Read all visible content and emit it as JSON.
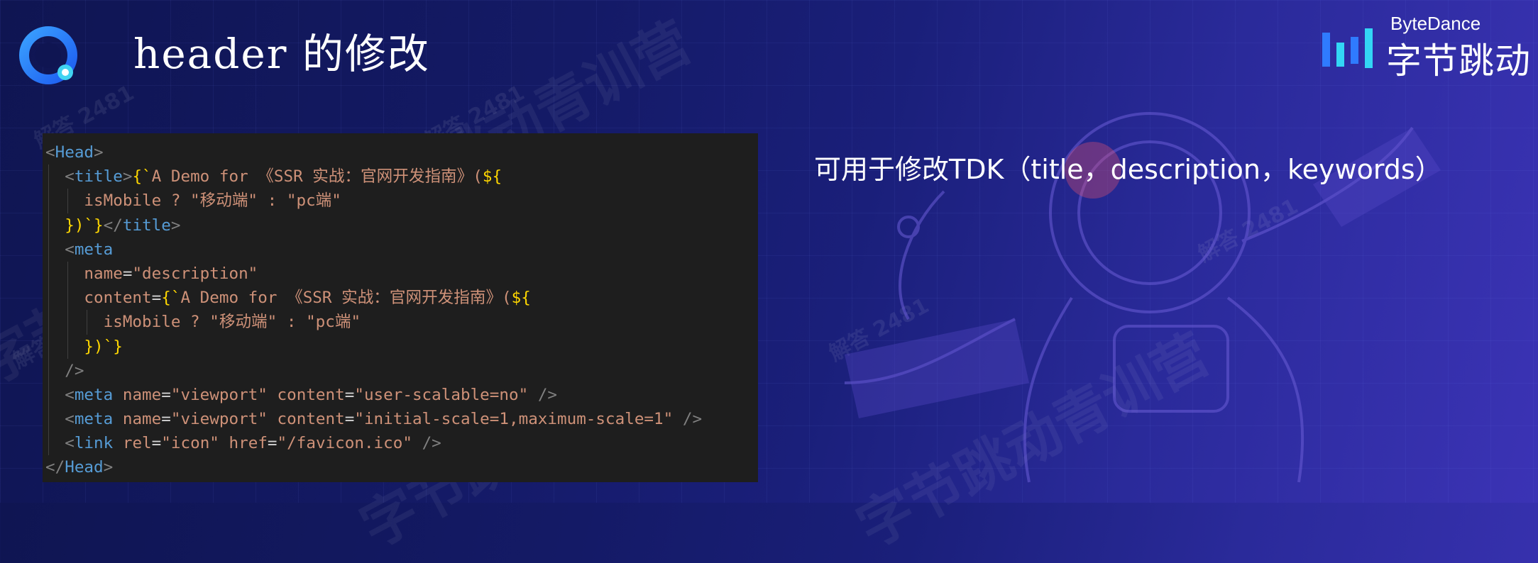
{
  "slide": {
    "title": "header 的修改",
    "description": "可用于修改TDK（title，description，keywords）"
  },
  "brand": {
    "name_en": "ByteDance",
    "name_cn": "字节跳动"
  },
  "watermarks": {
    "big": "字节跳动青训营",
    "small": "解答 2481"
  },
  "code": {
    "lines": [
      "<Head>",
      "  <title>{`A Demo for 《SSR 实战：官网开发指南》(${",
      "    isMobile ? \"移动端\" : \"pc端\"",
      "  })`}</title>",
      "  <meta",
      "    name=\"description\"",
      "    content={`A Demo for 《SSR 实战：官网开发指南》(${",
      "      isMobile ? \"移动端\" : \"pc端\"",
      "    })`}",
      "  />",
      "  <meta name=\"viewport\" content=\"user-scalable=no\" />",
      "  <meta name=\"viewport\" content=\"initial-scale=1,maximum-scale=1\" />",
      "  <link rel=\"icon\" href=\"/favicon.ico\" />",
      "</Head>"
    ]
  },
  "colors": {
    "background_start": "#0f1552",
    "background_end": "#3b33b5",
    "code_bg": "#1e1e1e",
    "tag": "#569cd6",
    "attr": "#9cdcfe",
    "string": "#ce9178",
    "brace": "#ffd700",
    "brand_blue": "#2f7bff",
    "brand_cyan": "#33d6f5"
  }
}
